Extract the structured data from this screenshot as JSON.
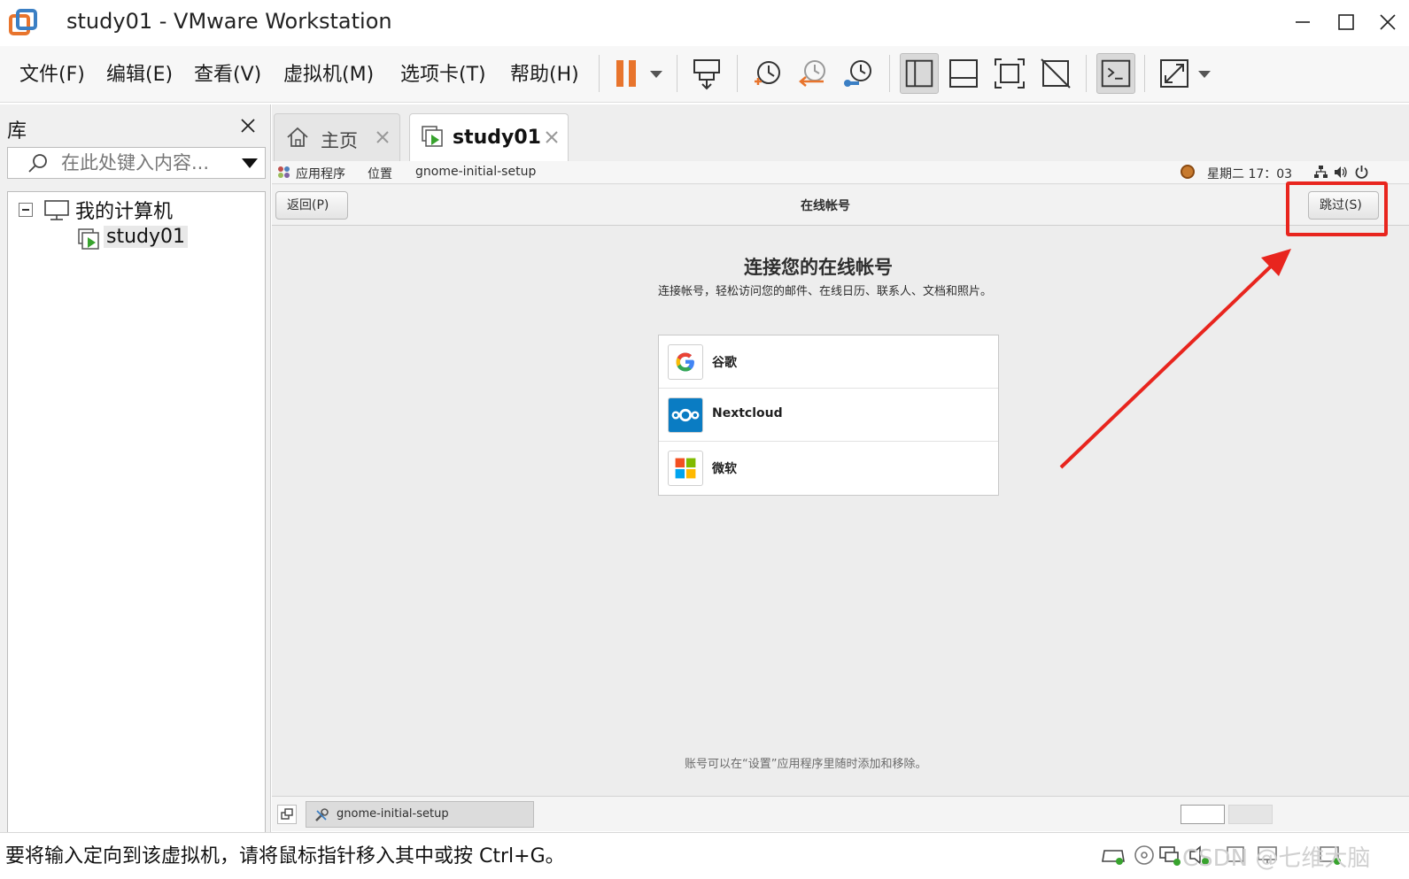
{
  "window": {
    "title": "study01 - VMware Workstation"
  },
  "menu": {
    "items": [
      "文件(F)",
      "编辑(E)",
      "查看(V)",
      "虚拟机(M)",
      "选项卡(T)",
      "帮助(H)"
    ]
  },
  "toolbar": {
    "icons": [
      "pause-icon",
      "dropdown-arrow-icon",
      "send-ctrl-alt-del-icon",
      "snapshot-icon",
      "revert-snapshot-icon",
      "snapshot-manager-icon",
      "library-view-icon",
      "thumbnail-bar-icon",
      "fullscreen-icon",
      "unity-icon",
      "console-view-icon",
      "stretch-icon"
    ],
    "pause_color": "#e8742c"
  },
  "library": {
    "title": "库",
    "search_placeholder": "在此处键入内容...",
    "tree": {
      "root_label": "我的计算机",
      "children": [
        "study01"
      ]
    }
  },
  "tabs": [
    {
      "label": "主页",
      "active": false
    },
    {
      "label": "study01",
      "active": true
    }
  ],
  "vm": {
    "topbar": {
      "applications": "应用程序",
      "places": "位置",
      "app_name": "gnome-initial-setup",
      "clock": "星期二 17：03"
    },
    "header": {
      "back": "返回(P)",
      "title": "在线帐号",
      "skip": "跳过(S)"
    },
    "page": {
      "title": "连接您的在线帐号",
      "description": "连接帐号，轻松访问您的邮件、在线日历、联系人、文档和照片。",
      "providers": [
        {
          "label": "谷歌",
          "icon": "google-icon"
        },
        {
          "label": "Nextcloud",
          "icon": "nextcloud-icon"
        },
        {
          "label": "微软",
          "icon": "microsoft-icon"
        }
      ],
      "footnote": "账号可以在“设置”应用程序里随时添加和移除。"
    },
    "taskbar": {
      "task_label": "gnome-initial-setup"
    }
  },
  "annotation": {
    "color": "#e8251e"
  },
  "status": {
    "text": "要将输入定向到该虚拟机，请将鼠标指针移入其中或按 Ctrl+G。",
    "credit": "CSDN @七维大脑"
  }
}
